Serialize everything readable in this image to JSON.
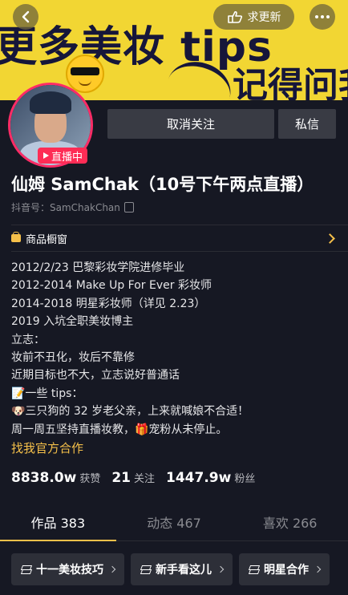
{
  "banner": {
    "line1": "更多美妆 tips",
    "line2": "记得问我"
  },
  "topbar": {
    "request_label": "求更新"
  },
  "profile": {
    "live_badge": "直播中",
    "unfollow_label": "取消关注",
    "message_label": "私信",
    "name": "仙姆 SamChak（10号下午两点直播）",
    "douyin_id": "抖音号：SamChakChan",
    "shop_label": "商品橱窗"
  },
  "bio": {
    "lines": [
      "2012/2/23 巴黎彩妆学院进修毕业",
      "2012-2014 Make Up For Ever 彩妆师",
      "2014-2018 明星彩妆师（详见 2.23）",
      "2019 入坑全职美妆博主",
      "立志：",
      "妆前不丑化，妆后不靠修",
      "近期目标也不大，立志说好普通话",
      "📝一些 tips：",
      "🐶三只狗的 32 岁老父亲，上来就喊娘不合适！",
      "周一周五坚持直播妆教，🎁宠粉从未停止。"
    ],
    "link": "找我官方合作"
  },
  "stats": {
    "likes_value": "8838.0w",
    "likes_label": "获赞",
    "following_value": "21",
    "following_label": "关注",
    "followers_value": "1447.9w",
    "followers_label": "粉丝"
  },
  "tabs": [
    {
      "label": "作品 383"
    },
    {
      "label": "动态 467"
    },
    {
      "label": "喜欢 266"
    }
  ],
  "chips": [
    {
      "label": "十一美妆技巧"
    },
    {
      "label": "新手看这儿"
    },
    {
      "label": "明星合作"
    }
  ],
  "colors": {
    "background": "#161823",
    "accent": "#f5c04a",
    "live": "#fe2c55",
    "banner": "#f2d633"
  }
}
